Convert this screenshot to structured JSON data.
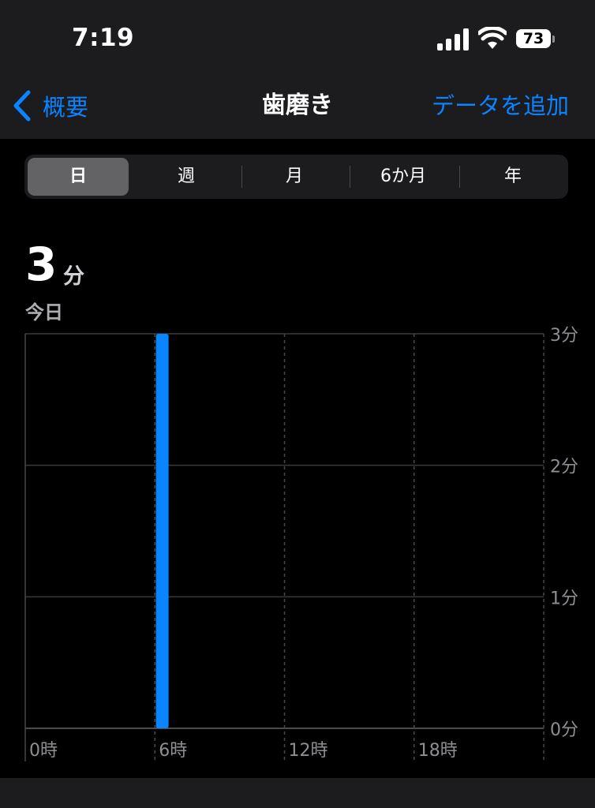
{
  "status_bar": {
    "time": "7:19",
    "battery": "73"
  },
  "nav": {
    "back_label": "概要",
    "title": "歯磨き",
    "add_label": "データを追加"
  },
  "segments": [
    "日",
    "週",
    "月",
    "6か月",
    "年"
  ],
  "summary": {
    "value": "3",
    "unit": "分",
    "period": "今日"
  },
  "colors": {
    "accent": "#0a84ff",
    "bar": "#0a84ff"
  },
  "chart_data": {
    "type": "bar",
    "x_ticks": [
      "0時",
      "6時",
      "12時",
      "18時"
    ],
    "y_ticks": [
      "0分",
      "1分",
      "2分",
      "3分"
    ],
    "ylim": [
      0,
      3
    ],
    "xlim": [
      0,
      24
    ],
    "bars": [
      {
        "hour": 7,
        "value": 3
      }
    ]
  }
}
